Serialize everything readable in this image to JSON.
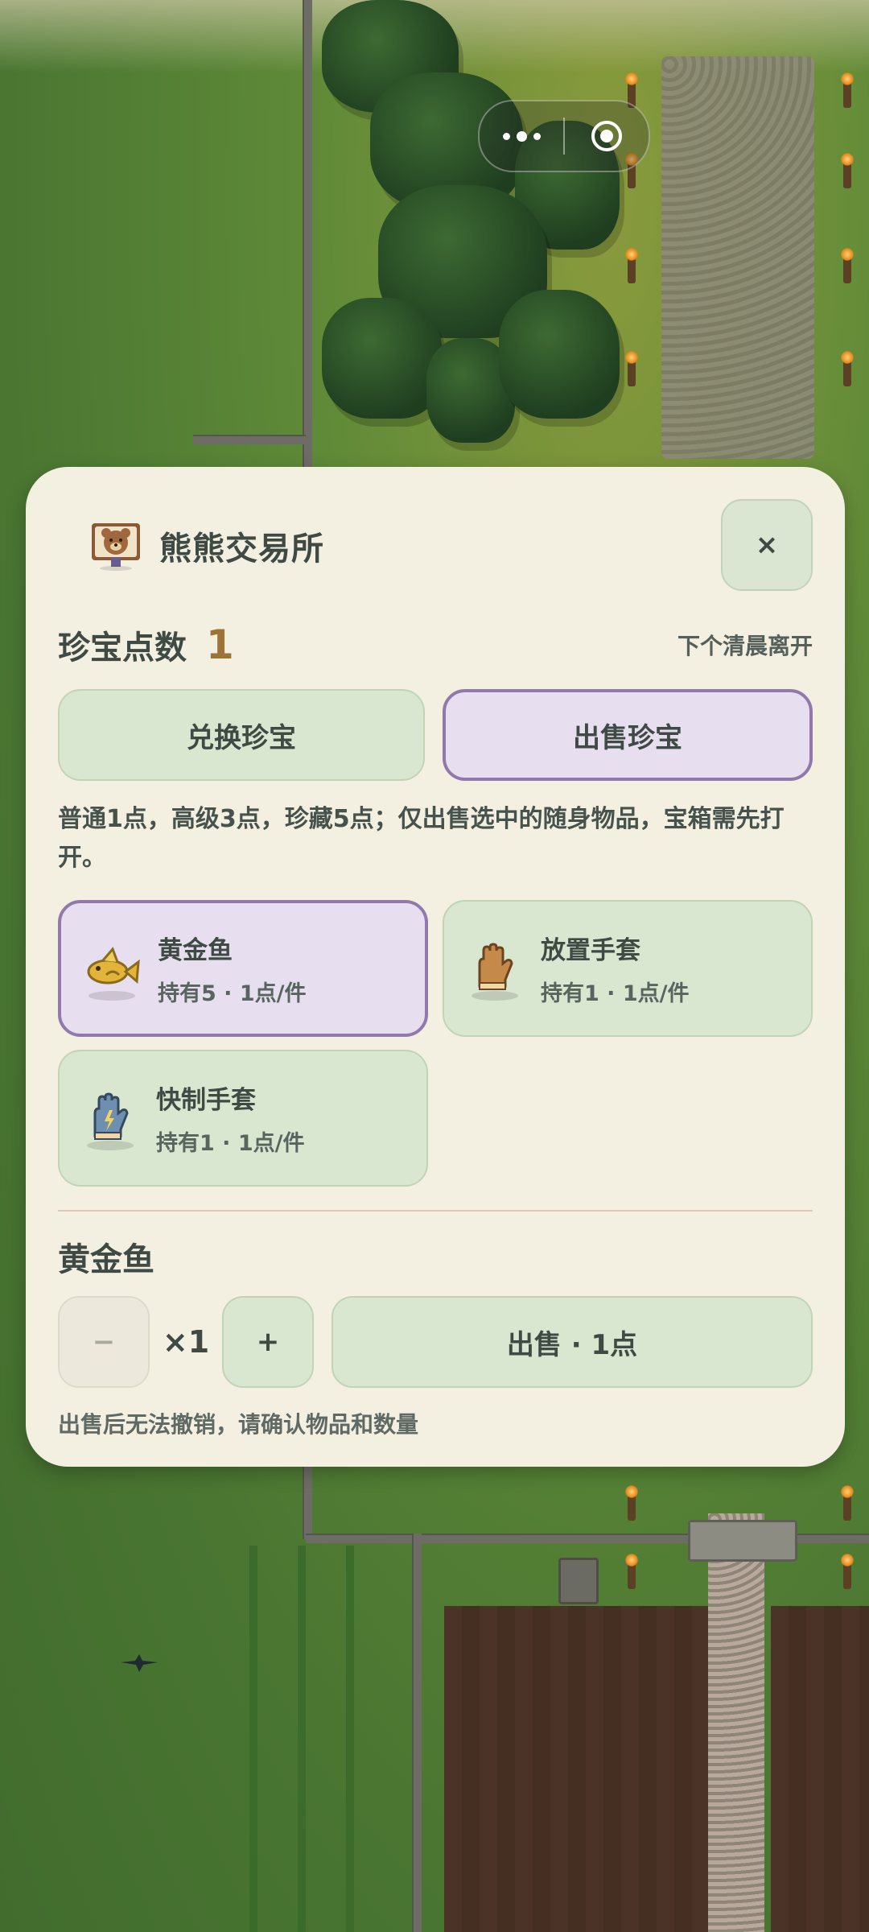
{
  "header": {
    "title": "熊熊交易所",
    "close_label": "×"
  },
  "points": {
    "label": "珍宝点数",
    "value": "1",
    "leave_note": "下个清晨离开"
  },
  "tabs": [
    {
      "label": "兑换珍宝",
      "selected": false
    },
    {
      "label": "出售珍宝",
      "selected": true
    }
  ],
  "description": "普通1点，高级3点，珍藏5点；仅出售选中的随身物品，宝箱需先打开。",
  "items": [
    {
      "name": "黄金鱼",
      "meta": "持有5 · 1点/件",
      "icon": "golden-fish-icon",
      "selected": true
    },
    {
      "name": "放置手套",
      "meta": "持有1 · 1点/件",
      "icon": "place-glove-icon",
      "selected": false
    },
    {
      "name": "快制手套",
      "meta": "持有1 · 1点/件",
      "icon": "quick-craft-glove-icon",
      "selected": false
    }
  ],
  "selection": {
    "name": "黄金鱼",
    "minus_label": "−",
    "quantity": "×1",
    "plus_label": "+",
    "sell_label": "出售 · 1点",
    "warning": "出售后无法撤销，请确认物品和数量"
  },
  "colors": {
    "panel_bg": "#f3f0e2",
    "green_button": "#d9e6d0",
    "purple_selected": "#e7def0",
    "purple_border": "#8f7aab",
    "points_accent": "#9b7436",
    "text": "#3f4a44"
  }
}
